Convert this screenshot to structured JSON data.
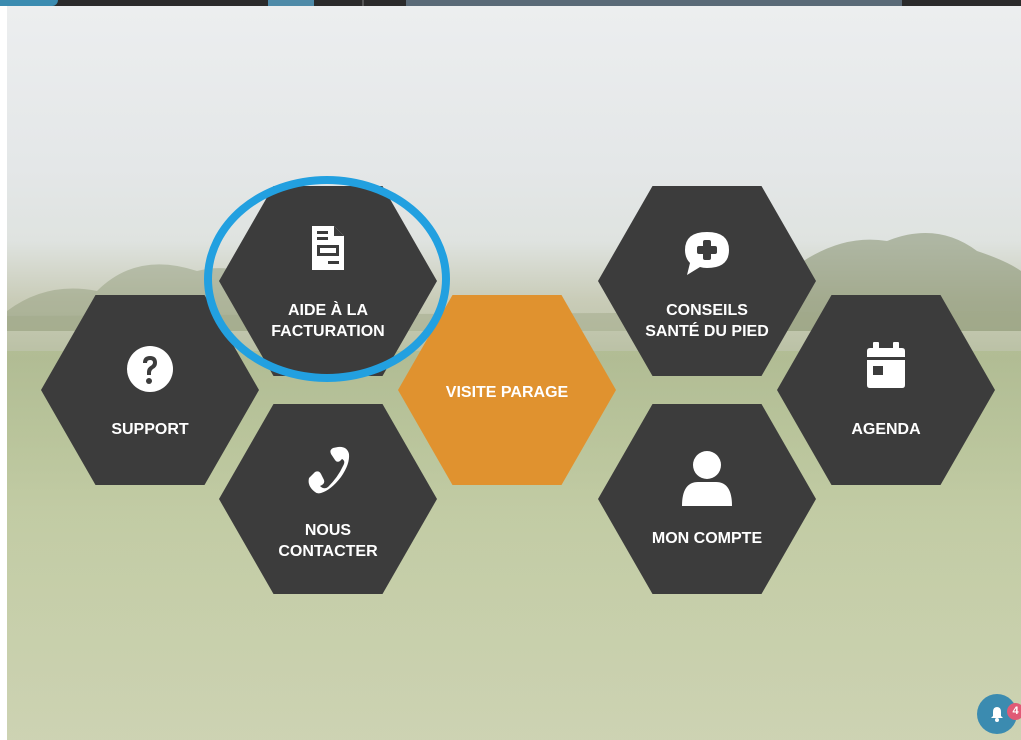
{
  "menu": {
    "aide_facturation": "AIDE À LA\nFACTURATION",
    "support": "SUPPORT",
    "nous_contacter": "NOUS\nCONTACTER",
    "visite_parage": "VISITE PARAGE",
    "conseils_sante": "CONSEILS\nSANTÉ DU PIED",
    "mon_compte": "MON COMPTE",
    "agenda": "AGENDA"
  },
  "notifications": {
    "count": "4"
  },
  "icons": {
    "aide_facturation": "invoice-icon",
    "support": "question-icon",
    "nous_contacter": "phone-icon",
    "conseils_sante": "chat-plus-icon",
    "mon_compte": "user-icon",
    "agenda": "calendar-icon",
    "notifications": "bell-icon"
  },
  "colors": {
    "tile": "#3c3c3c",
    "accent": "#e0922f",
    "highlight": "#22a0e0",
    "bell": "#3b8bb0",
    "badge": "#e05a76"
  }
}
